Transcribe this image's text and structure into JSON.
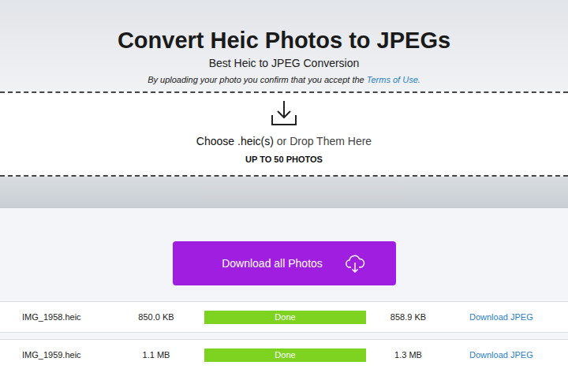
{
  "page": {
    "title": "Convert Heic Photos to JPEGs",
    "subtitle": "Best Heic to JPEG Conversion",
    "terms": {
      "text": "By uploading your photo you confirm that you accept the ",
      "link": "Terms of Use."
    }
  },
  "dropzone": {
    "choose": "Choose .heic(s)",
    "rest": " or Drop Them Here",
    "limit": "UP TO 50 PHOTOS"
  },
  "download_all": {
    "label": "Download all Photos"
  },
  "files": [
    {
      "name": "IMG_1958.heic",
      "size": "850.0 KB",
      "status": "Done",
      "level": 1,
      "result_size": "858.9 KB",
      "action": "Download JPEG"
    },
    {
      "name": "IMG_1959.heic",
      "size": "1.1 MB",
      "status": "Done",
      "level": 1,
      "result_size": "1.3 MB",
      "action": "Download JPEG"
    }
  ]
}
